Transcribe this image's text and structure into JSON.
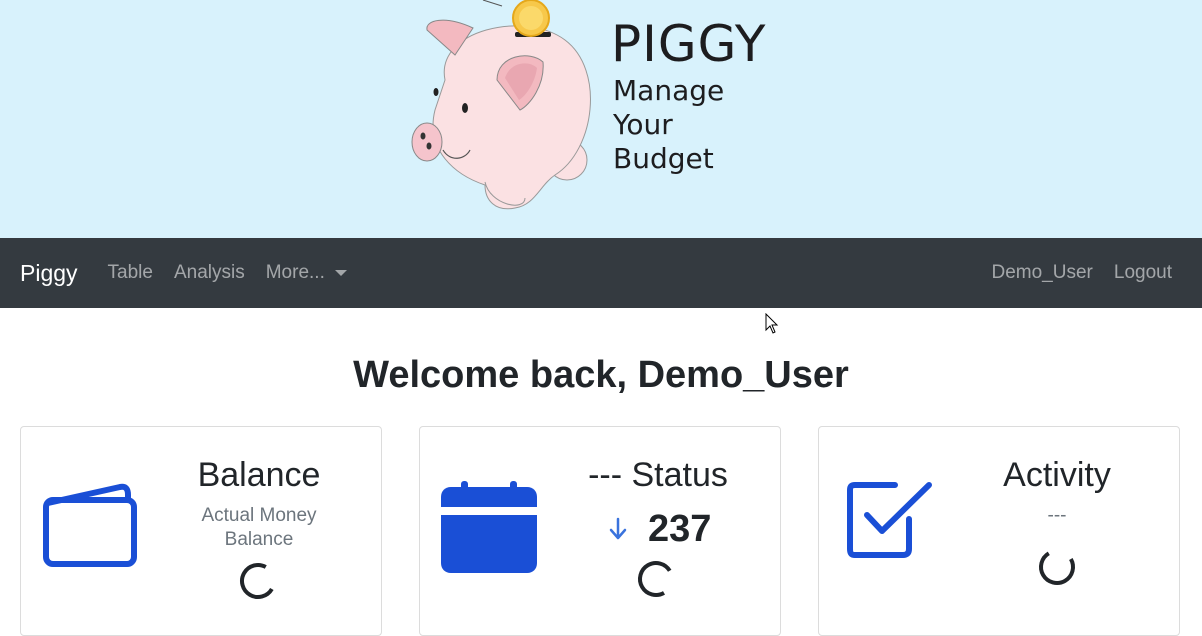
{
  "hero": {
    "logo_title": "PIGGY",
    "logo_tagline": [
      "Manage",
      "Your",
      "Budget"
    ]
  },
  "navbar": {
    "brand": "Piggy",
    "links": [
      "Table",
      "Analysis"
    ],
    "dropdown_label": "More...",
    "user": "Demo_User",
    "logout": "Logout"
  },
  "main": {
    "welcome": "Welcome back, Demo_User",
    "cards": {
      "balance": {
        "title": "Balance",
        "subtitle_line1": "Actual Money",
        "subtitle_line2": "Balance",
        "icon": "wallet-icon"
      },
      "status": {
        "title": "--- Status",
        "value": "237",
        "trend_icon": "arrow-down-icon",
        "icon": "calendar-icon"
      },
      "activity": {
        "title": "Activity",
        "subtitle": "---",
        "icon": "check-square-icon"
      }
    }
  },
  "colors": {
    "hero_bg": "#d8f2fc",
    "navbar_bg": "#343a40",
    "icon_blue": "#1a4fd6",
    "trend_blue": "#3a73dd",
    "spinner": "#212529"
  }
}
